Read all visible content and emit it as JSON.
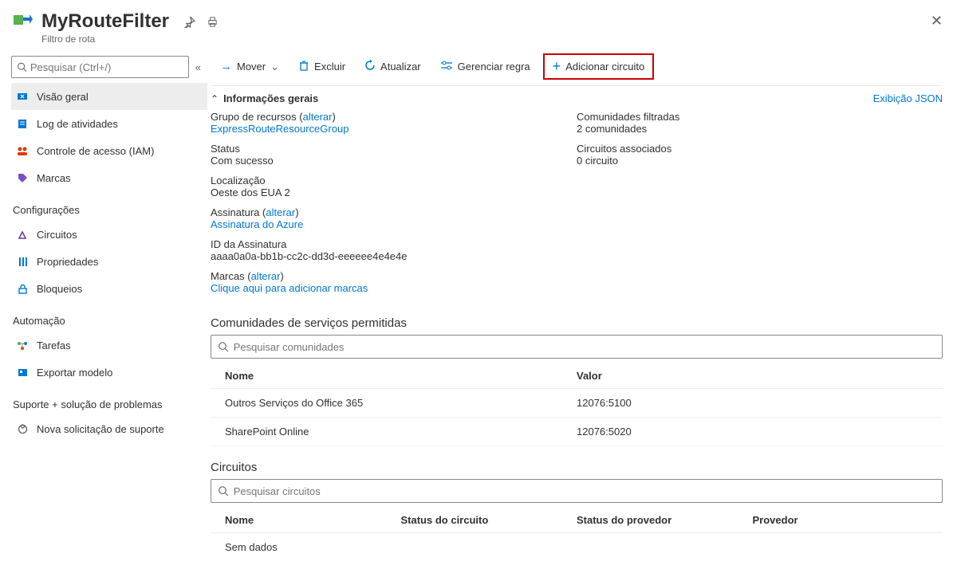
{
  "header": {
    "title": "MyRouteFilter",
    "subtitle": "Filtro de rota"
  },
  "sidebar": {
    "search_placeholder": "Pesquisar (Ctrl+/)",
    "items_top": [
      {
        "label": "Visão geral"
      },
      {
        "label": "Log de atividades"
      },
      {
        "label": "Controle de acesso (IAM)"
      },
      {
        "label": "Marcas"
      }
    ],
    "group_config": "Configurações",
    "items_config": [
      {
        "label": "Circuitos"
      },
      {
        "label": "Propriedades"
      },
      {
        "label": "Bloqueios"
      }
    ],
    "group_auto": "Automação",
    "items_auto": [
      {
        "label": "Tarefas"
      },
      {
        "label": "Exportar modelo"
      }
    ],
    "group_support": "Suporte + solução de problemas",
    "items_support": [
      {
        "label": "Nova solicitação de suporte"
      }
    ]
  },
  "toolbar": {
    "move": "Mover",
    "delete": "Excluir",
    "refresh": "Atualizar",
    "manage_rule": "Gerenciar regra",
    "add_circuit": "Adicionar circuito"
  },
  "essentials": {
    "title": "Informações gerais",
    "json_view": "Exibição JSON",
    "resource_group_label": "Grupo de recursos",
    "change": "alterar",
    "resource_group_value": "ExpressRouteResourceGroup",
    "status_label": "Status",
    "status_value": "Com sucesso",
    "location_label": "Localização",
    "location_value": "Oeste dos EUA 2",
    "subscription_label": "Assinatura",
    "subscription_value": "Assinatura do Azure",
    "subscription_id_label": "ID da Assinatura",
    "subscription_id_value": "aaaa0a0a-bb1b-cc2c-dd3d-eeeeee4e4e4e",
    "tags_label": "Marcas",
    "tags_action": "Clique aqui para adicionar marcas",
    "filtered_label": "Comunidades filtradas",
    "filtered_value": "2 comunidades",
    "circuits_label": "Circuitos associados",
    "circuits_value": "0 circuito"
  },
  "communities": {
    "title": "Comunidades de serviços permitidas",
    "search_placeholder": "Pesquisar comunidades",
    "col_name": "Nome",
    "col_value": "Valor",
    "rows": [
      {
        "name": "Outros Serviços do Office 365",
        "value": "12076:5100"
      },
      {
        "name": "SharePoint Online",
        "value": "12076:5020"
      }
    ]
  },
  "circuits": {
    "title": "Circuitos",
    "search_placeholder": "Pesquisar circuitos",
    "col_name": "Nome",
    "col_cstatus": "Status do circuito",
    "col_pstatus": "Status do provedor",
    "col_provider": "Provedor",
    "empty": "Sem dados"
  }
}
